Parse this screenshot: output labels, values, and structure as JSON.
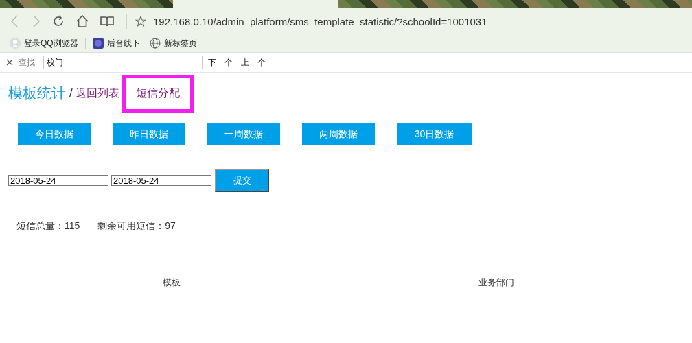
{
  "browser": {
    "address": "192.168.0.10/admin_platform/sms_template_statistic/?schoolId=1001031",
    "bookmarks": [
      {
        "kind": "avatar",
        "label": "登录QQ浏览器"
      },
      {
        "kind": "app",
        "label": "后台线下"
      },
      {
        "kind": "globe",
        "label": "新标签页"
      }
    ]
  },
  "find_bar": {
    "label": "查找",
    "value": "校门",
    "next": "下一个",
    "prev": "上一个"
  },
  "header": {
    "title": "模板统计",
    "separator": "/",
    "back_link": "返回列表",
    "allocate_link": "短信分配",
    "allocate_highlighted": true
  },
  "range_buttons": [
    "今日数据",
    "昨日数据",
    "一周数据",
    "两周数据",
    "30日数据"
  ],
  "date_form": {
    "start": "2018-05-24",
    "end": "2018-05-24",
    "submit": "提交"
  },
  "summary": [
    {
      "label": "短信总量：",
      "value": "115"
    },
    {
      "label": "剩余可用短信：",
      "value": "97"
    }
  ],
  "table": {
    "columns": [
      "模板",
      "业务部门"
    ]
  }
}
